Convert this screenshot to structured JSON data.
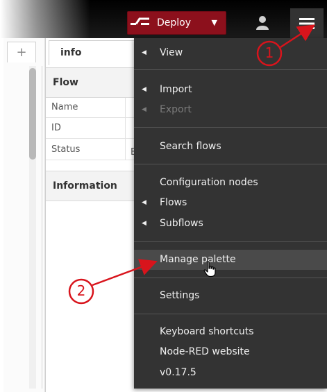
{
  "header": {
    "deploy_label": "Deploy",
    "icons": {
      "deploy": "deploy-icon",
      "caret": "caret-down-icon",
      "user": "user-icon",
      "menu": "hamburger-menu-icon"
    },
    "colors": {
      "deploy_bg": "#8c101c",
      "bar_bg": "#000000"
    }
  },
  "workspace": {
    "add_tab_label": "+"
  },
  "sidebar": {
    "tab_label": "info",
    "flow_section": "Flow",
    "props": [
      "Name",
      "ID",
      "Status"
    ],
    "status_value_partial": "E",
    "info_section": "Information"
  },
  "menu": {
    "items": [
      {
        "label": "View",
        "submenu": true,
        "disabled": false
      },
      {
        "label": "Import",
        "submenu": true,
        "disabled": false
      },
      {
        "label": "Export",
        "submenu": true,
        "disabled": true
      },
      {
        "label": "Search flows",
        "submenu": false,
        "disabled": false
      },
      {
        "label": "Configuration nodes",
        "submenu": false,
        "disabled": false
      },
      {
        "label": "Flows",
        "submenu": true,
        "disabled": false
      },
      {
        "label": "Subflows",
        "submenu": true,
        "disabled": false
      },
      {
        "label": "Manage palette",
        "submenu": false,
        "disabled": false,
        "hovered": true
      },
      {
        "label": "Settings",
        "submenu": false,
        "disabled": false
      },
      {
        "label": "Keyboard shortcuts",
        "submenu": false,
        "disabled": false
      },
      {
        "label": "Node-RED website",
        "submenu": false,
        "disabled": false
      },
      {
        "label": "v0.17.5",
        "submenu": false,
        "disabled": false
      }
    ],
    "arrow_glyph": "◀"
  },
  "annotations": {
    "callout_1": "1",
    "callout_2": "2",
    "color": "#d8141c"
  }
}
